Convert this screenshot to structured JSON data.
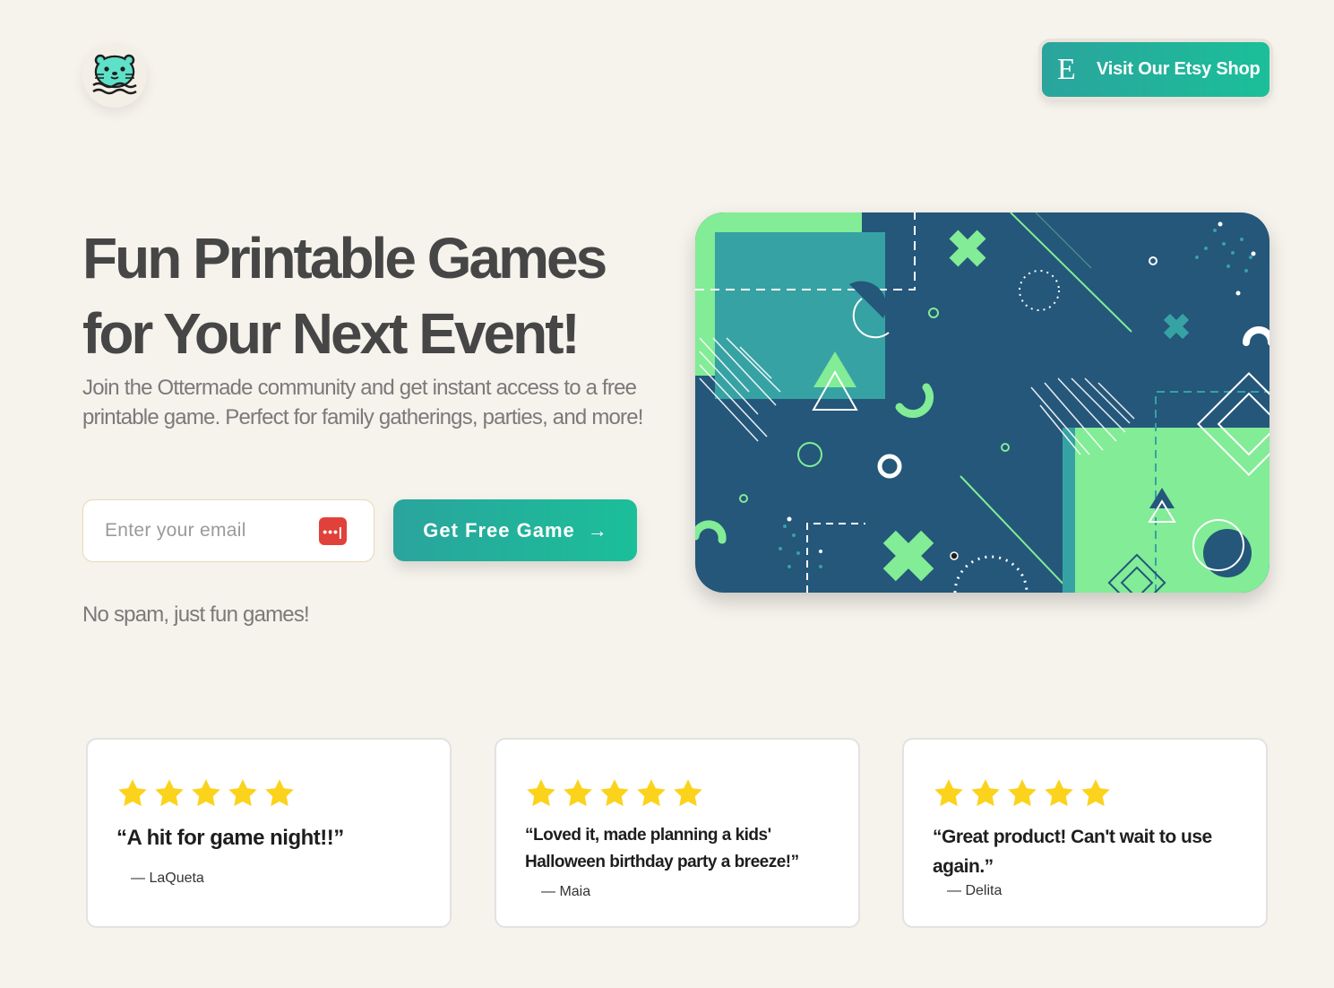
{
  "header": {
    "logo_icon": "otter-icon",
    "etsy_button": {
      "icon": "etsy-e-icon",
      "icon_glyph": "E",
      "label": "Visit Our Etsy Shop"
    }
  },
  "hero": {
    "headline_line1": "Fun Printable Games",
    "headline_line2": "for Your Next Event!",
    "subheading": "Join the Ottermade community and get instant access to a free printable game. Perfect for family gatherings, parties, and more!",
    "email_placeholder": "Enter your email",
    "password_manager_icon": "password-manager-icon",
    "cta_label": "Get Free Game",
    "cta_arrow": "→",
    "note": "No spam, just fun games!",
    "illustration": "abstract-geometric-pattern"
  },
  "colors": {
    "background": "#f6f2ec",
    "accent_teal": "#2aa49d",
    "accent_green": "#1bbf99",
    "art_navy": "#24577a",
    "art_mint": "#82ec96",
    "star_yellow": "#fbd31c",
    "text_dark": "#464646"
  },
  "testimonials": [
    {
      "rating": 5,
      "quote": "“A hit for game night!!”",
      "author": "— LaQueta"
    },
    {
      "rating": 5,
      "quote": "“Loved it, made planning a kids' Halloween birthday party a breeze!”",
      "author": "— Maia"
    },
    {
      "rating": 5,
      "quote": "“Great product! Can't wait to use again.”",
      "author": "— Delita"
    }
  ]
}
